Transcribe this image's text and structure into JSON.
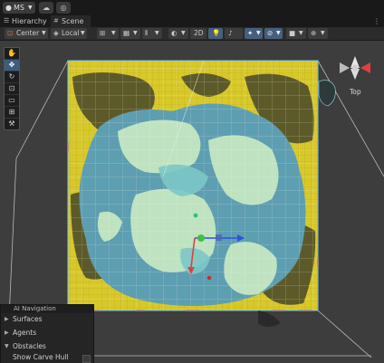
{
  "topbar": {
    "account_label": "MS",
    "cloud_icon": "cloud-icon",
    "collab_icon": "history-icon"
  },
  "tabs": [
    {
      "label": "Hierarchy",
      "icon": "hierarchy-icon"
    },
    {
      "label": "Scene",
      "icon": "scene-icon"
    }
  ],
  "toolbar": {
    "pivot_mode": "Center",
    "pivot_rotation": "Local",
    "mode_2d": "2D"
  },
  "gizmo": {
    "view_label": "Top"
  },
  "tools": [
    "hand-tool",
    "move-tool",
    "rotate-tool",
    "scale-tool",
    "rect-tool",
    "transform-tool",
    "custom-tool"
  ],
  "ai_navigation": {
    "title": "AI Navigation",
    "items": [
      "Surfaces",
      "Agents",
      "Obstacles"
    ],
    "option": "Show Carve Hull"
  },
  "colors": {
    "terrain_yellow": "#d8c92a",
    "navmesh_teal": "#8fd0c4",
    "navmesh_light": "#bfe3c1",
    "rock_dark": "#5d5a2a",
    "axis_red": "#e04040",
    "axis_blue": "#3050e0",
    "axis_green": "#40c040"
  }
}
